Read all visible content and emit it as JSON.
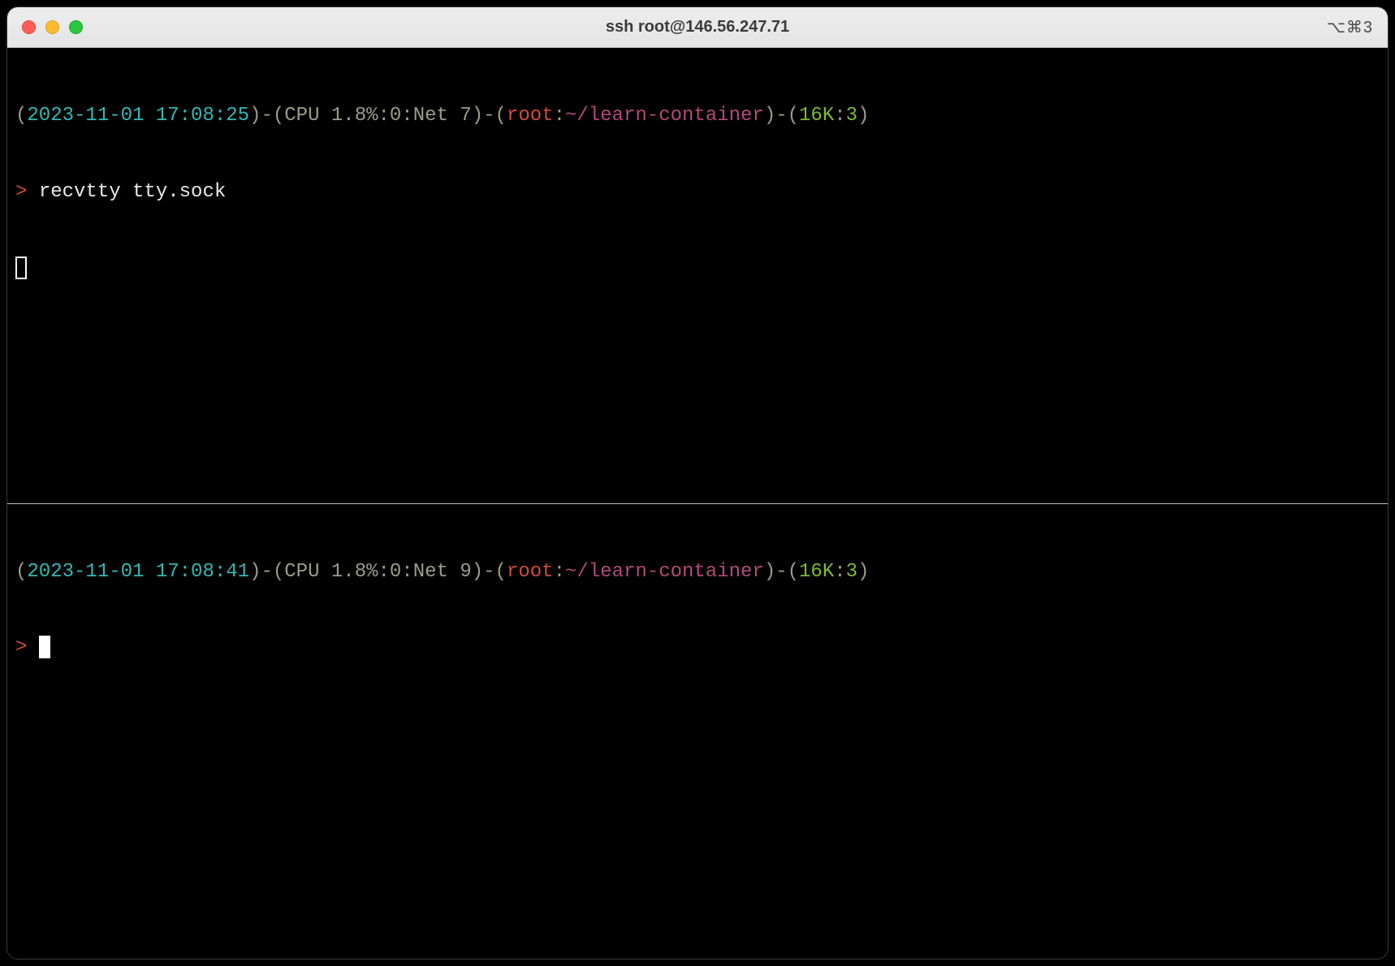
{
  "window": {
    "title": "ssh root@146.56.247.71",
    "shortcut": "⌥⌘3"
  },
  "panes": [
    {
      "prompt": {
        "paren_open": "(",
        "timestamp": "2023-11-01 17:08:25",
        "paren_close_dash_open": ")-(",
        "stats_prefix": "CPU 1.8%:0:Net ",
        "stats_value": "7",
        "user": "root",
        "colon": ":",
        "path": "~/learn-container",
        "size": "16K",
        "size_jobs_sep": ":",
        "jobs": "3",
        "paren_close": ")",
        "dash_open": "-(",
        "prompt_char": ">"
      },
      "command": "recvtty tty.sock",
      "cursor_style": "outline"
    },
    {
      "prompt": {
        "paren_open": "(",
        "timestamp": "2023-11-01 17:08:41",
        "paren_close_dash_open": ")-(",
        "stats_prefix": "CPU 1.8%:0:Net ",
        "stats_value": "9",
        "user": "root",
        "colon": ":",
        "path": "~/learn-container",
        "size": "16K",
        "size_jobs_sep": ":",
        "jobs": "3",
        "paren_close": ")",
        "dash_open": "-(",
        "prompt_char": ">"
      },
      "command": "",
      "cursor_style": "block"
    }
  ]
}
